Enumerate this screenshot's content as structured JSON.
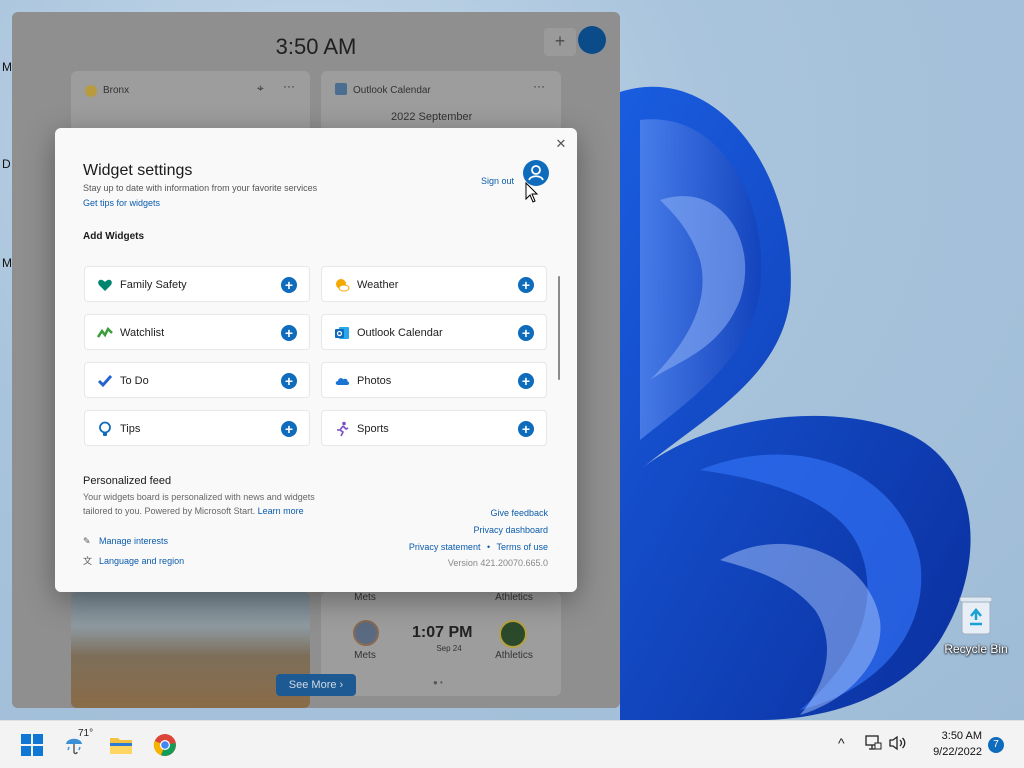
{
  "desktop": {
    "edge_letters": [
      "M",
      "D",
      "M"
    ],
    "recycle_bin_label": "Recycle Bin"
  },
  "board": {
    "time": "3:50 AM",
    "plus_label": "+",
    "weather_card": {
      "location": "Bronx",
      "icon": "weather-icon"
    },
    "calendar_card": {
      "title": "Outlook Calendar",
      "month": "2022 September"
    },
    "sports": {
      "team_left": "Mets",
      "team_right": "Athletics",
      "game_time": "1:07 PM",
      "game_date": "Sep 24"
    },
    "see_more": "See More"
  },
  "dialog": {
    "title": "Widget settings",
    "subtitle": "Stay up to date with information from your favorite services",
    "tips_link": "Get tips for widgets",
    "sign_out": "Sign out",
    "add_widgets_title": "Add Widgets",
    "widgets": [
      {
        "label": "Family Safety",
        "icon": "heart-icon",
        "color": "#00856f"
      },
      {
        "label": "Weather",
        "icon": "sun-cloud-icon",
        "color": "#f2a900"
      },
      {
        "label": "Watchlist",
        "icon": "stock-chart-icon",
        "color": "#3b9c3b"
      },
      {
        "label": "Outlook Calendar",
        "icon": "outlook-icon",
        "color": "#0f6cbd"
      },
      {
        "label": "To Do",
        "icon": "checkmark-icon",
        "color": "#2564cf"
      },
      {
        "label": "Photos",
        "icon": "cloud-icon",
        "color": "#1b74d3"
      },
      {
        "label": "Tips",
        "icon": "lightbulb-icon",
        "color": "#0f6cbd"
      },
      {
        "label": "Sports",
        "icon": "runner-icon",
        "color": "#7b4fc4"
      }
    ],
    "feed_title": "Personalized feed",
    "feed_desc": "Your widgets board is personalized with news and widgets tailored to you. Powered by Microsoft Start.",
    "learn_more": "Learn more",
    "manage_interests": "Manage interests",
    "language_region": "Language and region",
    "give_feedback": "Give feedback",
    "privacy_dashboard": "Privacy dashboard",
    "privacy_statement": "Privacy statement",
    "separator": "•",
    "terms_of_use": "Terms of use",
    "version": "Version 421.20070.665.0",
    "close_label": "✕"
  },
  "taskbar": {
    "weather_temp": "71°",
    "clock_time": "3:50 AM",
    "clock_date": "9/22/2022",
    "notification_count": "7"
  }
}
